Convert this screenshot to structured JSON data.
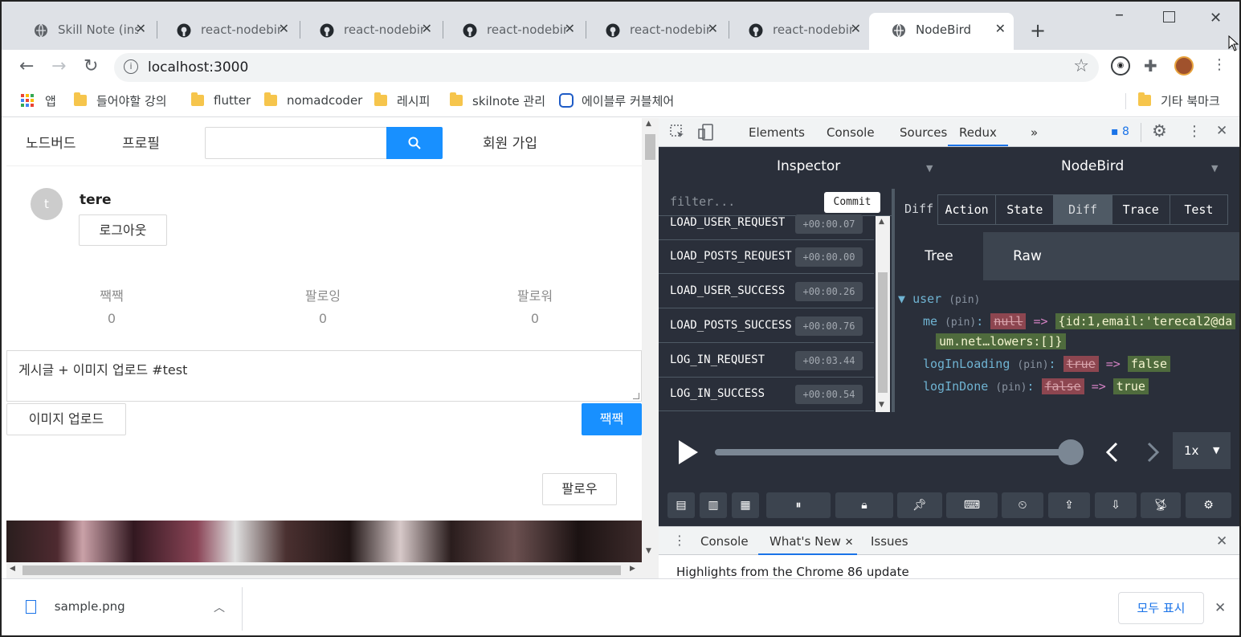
{
  "browser": {
    "tabs": [
      {
        "label": "Skill Note (insert",
        "icon": "globe-icon"
      },
      {
        "label": "react-nodebird",
        "icon": "github-icon"
      },
      {
        "label": "react-nodebird",
        "icon": "github-icon"
      },
      {
        "label": "react-nodebird",
        "icon": "github-icon"
      },
      {
        "label": "react-nodebird",
        "icon": "github-icon"
      },
      {
        "label": "react-nodebird",
        "icon": "github-icon"
      },
      {
        "label": "NodeBird",
        "icon": "globe-icon",
        "active": true
      }
    ],
    "close_glyph": "✕",
    "new_tab_glyph": "+",
    "url": "localhost:3000",
    "bookmarks": [
      {
        "label": "앱",
        "icon": "apps-icon"
      },
      {
        "label": "들어야할 강의",
        "icon": "folder-icon"
      },
      {
        "label": "flutter",
        "icon": "folder-icon"
      },
      {
        "label": "nomadcoder",
        "icon": "folder-icon"
      },
      {
        "label": "레시피",
        "icon": "folder-icon"
      },
      {
        "label": "skilnote 관리",
        "icon": "folder-icon"
      },
      {
        "label": "에이블루 커블체어",
        "icon": "link-icon"
      },
      {
        "label": "기타 북마크",
        "icon": "folder-icon"
      }
    ]
  },
  "app": {
    "menu": {
      "home": "노드버드",
      "profile": "프로필",
      "signup": "회원 가입"
    },
    "search": {
      "value": "",
      "placeholder": ""
    },
    "user": {
      "avatar_letter": "t",
      "name": "tere",
      "logout": "로그아웃"
    },
    "stats": [
      {
        "label": "짹짹",
        "value": "0"
      },
      {
        "label": "팔로잉",
        "value": "0"
      },
      {
        "label": "팔로워",
        "value": "0"
      }
    ],
    "post_form": {
      "text": "게시글 + 이미지 업로드 #test",
      "upload": "이미지 업로드",
      "submit": "짹짹"
    },
    "follow_button": "팔로우"
  },
  "devtools": {
    "tabs": [
      "Elements",
      "Console",
      "Sources",
      "Redux"
    ],
    "more": "»",
    "message_count": "8",
    "redux": {
      "inspector_label": "Inspector",
      "instance_label": "NodeBird",
      "filter_placeholder": "filter...",
      "commit_label": "Commit",
      "actions": [
        {
          "name": "LOAD_USER_REQUEST",
          "time": "+00:00.07"
        },
        {
          "name": "LOAD_POSTS_REQUEST",
          "time": "+00:00.00"
        },
        {
          "name": "LOAD_USER_SUCCESS",
          "time": "+00:00.26"
        },
        {
          "name": "LOAD_POSTS_SUCCESS",
          "time": "+00:00.76"
        },
        {
          "name": "LOG_IN_REQUEST",
          "time": "+00:03.44"
        },
        {
          "name": "LOG_IN_SUCCESS",
          "time": "+00:00.54"
        }
      ],
      "diff_label": "Diff",
      "monitor_tabs": [
        "Action",
        "State",
        "Diff",
        "Trace",
        "Test"
      ],
      "selected_monitor_tab": "Diff",
      "view_tabs": [
        "Tree",
        "Raw"
      ],
      "tree": {
        "root_key": "user",
        "pin": "(pin)",
        "arrow": "=>",
        "me_key": "me",
        "me_old": "null",
        "me_new_line1": "{id:1,email:'terecal2@da",
        "me_new_line2": "um.net…lowers:[]}",
        "loading_key": "logInLoading",
        "loading_old": "true",
        "loading_new": "false",
        "done_key": "logInDone",
        "done_old": "false",
        "done_new": "true"
      },
      "speed": "1x",
      "slider_progress": 1.0
    },
    "drawer": {
      "tabs": [
        "Console",
        "What's New",
        "Issues"
      ],
      "active": "What's New",
      "body": "Highlights from the Chrome 86 update"
    }
  },
  "downloads": {
    "file": "sample.png",
    "show_all": "모두 표시"
  },
  "colors": {
    "accent": "#1890ff",
    "redux_bg": "#2a2f3a",
    "diff_old": "#8d4650",
    "diff_new": "#4f6b3d"
  }
}
